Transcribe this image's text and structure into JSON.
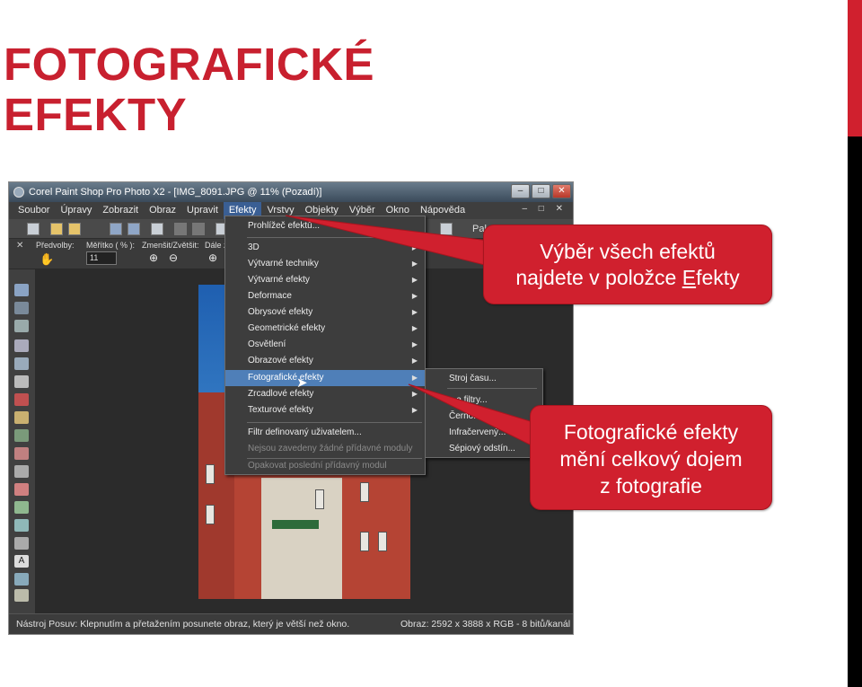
{
  "slide": {
    "title_line1": "FOTOGRAFICKÉ",
    "title_line2": "EFEKTY",
    "accent_color": "#d0202e"
  },
  "window": {
    "title": "Corel Paint Shop Pro Photo X2 - [IMG_8091.JPG @  11% (Pozadí)]",
    "buttons": [
      "–",
      "□",
      "✕"
    ],
    "mdi_controls": "– □ ✕"
  },
  "menubar": {
    "items": [
      "Soubor",
      "Úpravy",
      "Zobrazit",
      "Obraz",
      "Upravit",
      "Efekty",
      "Vrstvy",
      "Objekty",
      "Výběr",
      "Okno",
      "Nápověda"
    ]
  },
  "toolbar": {
    "palette_label": "Pale"
  },
  "tool_options": {
    "presets_label": "Předvolby:",
    "scale_label": "Měřítko ( % ):",
    "scale_value": "11",
    "zoom_label": "Zmenšit/Zvětšit:",
    "next_label": "Dále zvě"
  },
  "effects_menu": {
    "items": [
      {
        "label": "Prohlížeč efektů...",
        "submenu": false
      },
      {
        "label": "3D",
        "submenu": true
      },
      {
        "label": "Výtvarné techniky",
        "submenu": true
      },
      {
        "label": "Výtvarné efekty",
        "submenu": true
      },
      {
        "label": "Deformace",
        "submenu": true
      },
      {
        "label": "Obrysové efekty",
        "submenu": true
      },
      {
        "label": "Geometrické efekty",
        "submenu": true
      },
      {
        "label": "Osvětlení",
        "submenu": true
      },
      {
        "label": "Obrazové efekty",
        "submenu": true
      },
      {
        "label": "Fotografické efekty",
        "submenu": true
      },
      {
        "label": "Zrcadlové efekty",
        "submenu": true
      },
      {
        "label": "Texturové efekty",
        "submenu": true
      },
      {
        "label": "Filtr definovaný uživatelem...",
        "submenu": false
      },
      {
        "label": "Nejsou zavedeny žádné přídavné moduly",
        "submenu": false
      },
      {
        "label": "Opakovat poslední přídavný modul",
        "submenu": false
      }
    ]
  },
  "photo_submenu": {
    "items": [
      "Stroj času...",
      "...a filtry...",
      "Černo...",
      "Infračervený...",
      "Sépiový odstín..."
    ]
  },
  "statusbar": {
    "left": "Nástroj Posuv: Klepnutím a přetažením posunete obraz, který je větší než okno.",
    "right": "Obraz:  2592 x 3888 x RGB - 8 bitů/kanál"
  },
  "callouts": {
    "first_line1": "Výběr všech efektů",
    "first_line2_prefix": "najdete v položce ",
    "first_line2_hot": "E",
    "first_line2_rest": "fekty",
    "second_line1": "Fotografické efekty",
    "second_line2": "mění celkový dojem",
    "second_line3": "z fotografie"
  }
}
